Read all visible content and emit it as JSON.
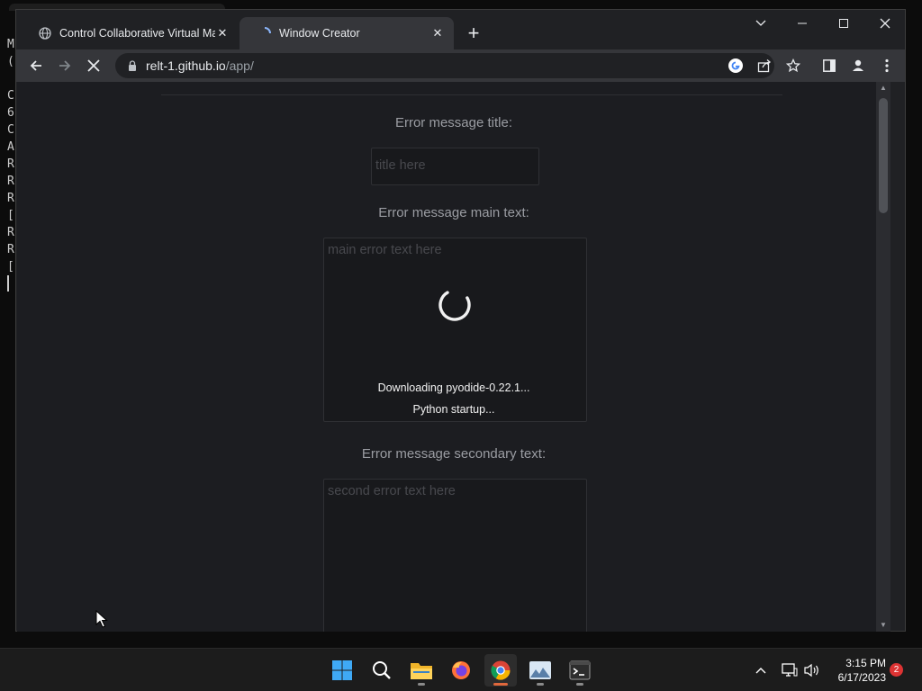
{
  "terminal": {
    "lines": [
      "M",
      "(",
      "",
      "C",
      "6",
      "C",
      "A",
      "R",
      "R",
      "R",
      "[",
      "R",
      "R",
      "["
    ]
  },
  "browser": {
    "tabs": [
      {
        "title": "Control Collaborative Virtual Machine",
        "icon": "globe-icon",
        "close": "✕"
      },
      {
        "title": "Window Creator",
        "icon": "loading-icon",
        "close": "✕"
      }
    ],
    "new_tab": "+",
    "address": {
      "host": "relt-1.github.io",
      "path": "/app/"
    }
  },
  "page": {
    "title_label": "Error message title:",
    "title_placeholder": "title here",
    "main_label": "Error message main text:",
    "main_placeholder": "main error text here",
    "secondary_label": "Error message secondary text:",
    "secondary_placeholder": "second error text here",
    "loading": {
      "line1": "Downloading pyodide-0.22.1...",
      "line2": "Python startup..."
    }
  },
  "taskbar": {
    "time": "3:15 PM",
    "date": "6/17/2023",
    "notifications": "2",
    "apps": [
      "start-icon",
      "search-icon",
      "file-explorer-icon",
      "firefox-icon",
      "chrome-icon",
      "photos-icon",
      "terminal-icon"
    ]
  },
  "colors": {
    "page_bg": "#1c1d21",
    "accent": "#e0683c",
    "field_bg": "#18191c"
  }
}
